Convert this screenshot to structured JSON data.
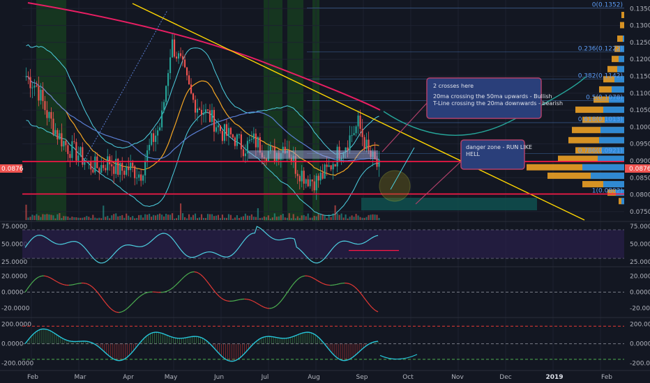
{
  "colors": {
    "background": "#131722",
    "grid": "#1e2230",
    "up_candle": "#26a69a",
    "down_candle": "#ef5350",
    "green_zone": "#1b5e20",
    "bollinger": "#4dd0e1",
    "ma20": "#f5a623",
    "ma50": "#5b7fd4",
    "ma200": "#e91e63",
    "trendline": "#ffd600",
    "support": "#ff1744",
    "fib": "#5b9cf6",
    "note_box": "#2a3f7a",
    "note_border": "#b0406a",
    "rsi": "#4dd0e1",
    "rsi_band": "#2a1f4a",
    "osc_up": "#4caf50",
    "osc_down": "#e53935",
    "cci": "#26c6da",
    "danger_box": "#0f4d4d",
    "volume_profile_up": "#1e88e5",
    "volume_profile_down": "#f9a825"
  },
  "price_axis": {
    "ticks": [
      "0.1350",
      "0.1300",
      "0.1250",
      "0.1200",
      "0.1150",
      "0.1100",
      "0.1050",
      "0.1000",
      "0.0950",
      "0.0900",
      "0.0850",
      "0.0800",
      "0.0750"
    ],
    "current_price": "0.0876",
    "current_price_right": "0.0876"
  },
  "rsi_axis": {
    "ticks": [
      "75.0000",
      "50.0000",
      "25.0000"
    ]
  },
  "osc_axis": {
    "ticks": [
      "20.0000",
      "0.0000",
      "-20.0000"
    ]
  },
  "cci_axis": {
    "ticks": [
      "200.0000",
      "0.0000",
      "-200.0000"
    ]
  },
  "time_axis": {
    "labels": [
      "Feb",
      "Mar",
      "Apr",
      "May",
      "Jun",
      "Jul",
      "Aug",
      "Sep",
      "Oct",
      "Nov",
      "Dec",
      "2019",
      "Feb"
    ]
  },
  "fib_levels": [
    {
      "label": "0(0.1352)",
      "value": 0.1352
    },
    {
      "label": "0.236(0.1222)",
      "value": 0.1222
    },
    {
      "label": "0.382(0.1142)",
      "value": 0.1142
    },
    {
      "label": "0.5(0.1078)",
      "value": 0.1078
    },
    {
      "label": "0.618(0.1013)",
      "value": 0.1013
    },
    {
      "label": "0.786(0.0921)",
      "value": 0.0921
    },
    {
      "label": "1(0.0802)",
      "value": 0.0802
    }
  ],
  "annotations": {
    "crosses_title": "2 crosses here",
    "crosses_line1": "20ma crossing the 50ma upwards - Bullish",
    "crosses_line2": "T-Line crossing the 20ma downwards - bearish",
    "danger_line1": "danger zone - RUN LIKE",
    "danger_line2": "HELL"
  },
  "chart_data": {
    "type": "candlestick",
    "symbol_note": "",
    "price_range": [
      0.0725,
      0.1365
    ],
    "support_levels": [
      0.0898,
      0.0802
    ],
    "trendline": {
      "from": [
        "2018-01-20",
        0.1365
      ],
      "to": [
        "2018-11-25",
        0.0725
      ]
    },
    "closes_weekly": [
      0.115,
      0.112,
      0.104,
      0.098,
      0.094,
      0.092,
      0.089,
      0.088,
      0.09,
      0.087,
      0.088,
      0.086,
      0.095,
      0.101,
      0.125,
      0.118,
      0.108,
      0.105,
      0.102,
      0.098,
      0.097,
      0.094,
      0.096,
      0.093,
      0.092,
      0.095,
      0.088,
      0.085,
      0.084,
      0.087,
      0.092,
      0.096,
      0.101,
      0.092,
      0.0876
    ],
    "rsi": {
      "ylim": [
        20,
        80
      ],
      "last": 40
    },
    "oscillator": {
      "ylim": [
        -30,
        30
      ]
    },
    "cci": {
      "ylim": [
        -260,
        240
      ]
    }
  }
}
